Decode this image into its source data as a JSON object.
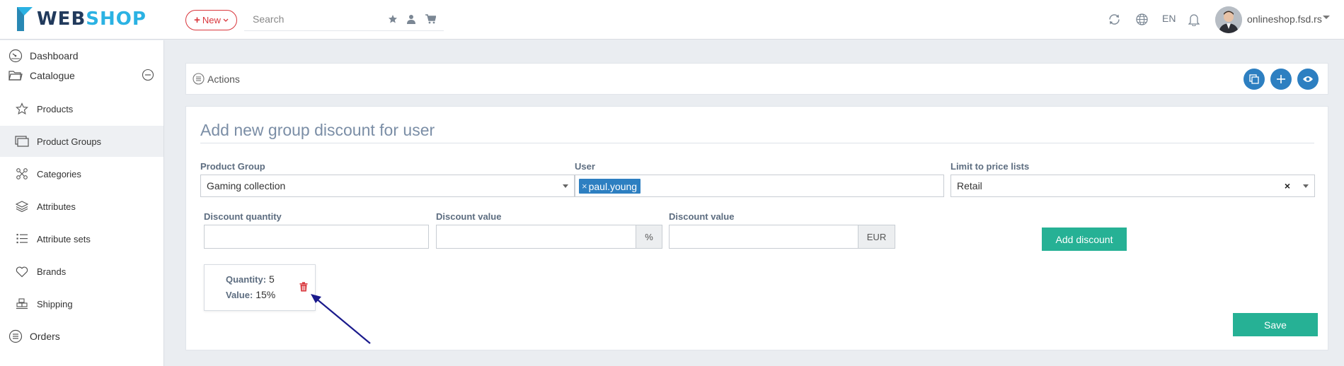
{
  "header": {
    "logo_web": "WEB",
    "logo_shop": "SHOP",
    "new_button_label": "New",
    "search_placeholder": "Search",
    "language": "EN",
    "account_name": "onlineshop.fsd.rs"
  },
  "sidebar": {
    "items": [
      {
        "label": "Dashboard",
        "icon": "dashboard-icon"
      },
      {
        "label": "Catalogue",
        "icon": "folder-icon"
      },
      {
        "label": "Products",
        "icon": "star-icon"
      },
      {
        "label": "Product Groups",
        "icon": "product-groups-icon"
      },
      {
        "label": "Categories",
        "icon": "categories-icon"
      },
      {
        "label": "Attributes",
        "icon": "layers-icon"
      },
      {
        "label": "Attribute sets",
        "icon": "list-icon"
      },
      {
        "label": "Brands",
        "icon": "heart-icon"
      },
      {
        "label": "Shipping",
        "icon": "shipping-icon"
      },
      {
        "label": "Orders",
        "icon": "orders-icon"
      }
    ]
  },
  "actions": {
    "label": "Actions"
  },
  "form": {
    "title": "Add new group discount for user",
    "product_group_label": "Product Group",
    "product_group_value": "Gaming collection",
    "user_label": "User",
    "user_tag": "paul.young",
    "price_list_label": "Limit to price lists",
    "price_list_value": "Retail",
    "discount_quantity_label": "Discount quantity",
    "discount_value_percent_label": "Discount value",
    "percent_addon": "%",
    "discount_value_amount_label": "Discount value",
    "currency_addon": "EUR",
    "add_discount_label": "Add discount",
    "save_label": "Save"
  },
  "discount_card": {
    "quantity_label": "Quantity:",
    "quantity_value": "5",
    "value_label": "Value:",
    "value_value": "15%"
  },
  "colors": {
    "accent_blue": "#2d7fc1",
    "accent_green": "#26b195",
    "danger_red": "#d9373d",
    "annotation_arrow": "#1a1a8c"
  }
}
